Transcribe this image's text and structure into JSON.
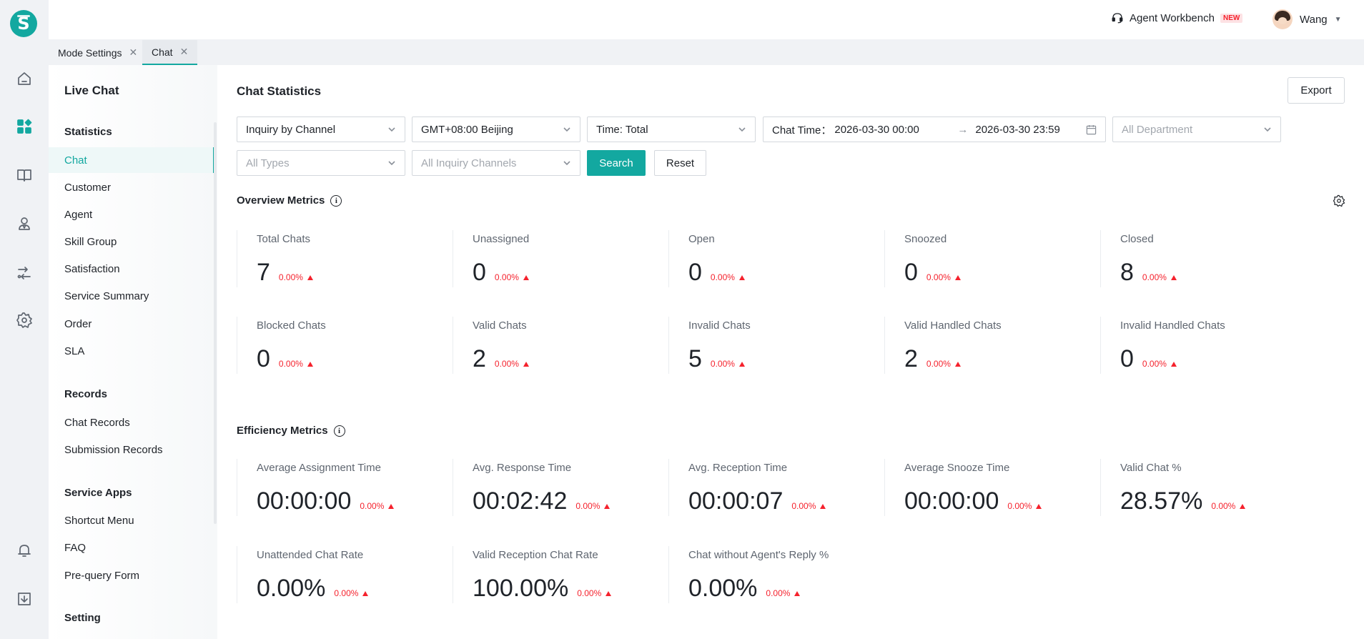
{
  "header": {
    "workbench_label": "Agent Workbench",
    "workbench_badge": "NEW",
    "user_name": "Wang"
  },
  "tabs": [
    {
      "label": "Mode Settings",
      "close": "✕"
    },
    {
      "label": "Chat",
      "close": "✕"
    }
  ],
  "sidebar": {
    "title": "Live Chat",
    "sections": {
      "statistics": "Statistics",
      "records": "Records",
      "service_apps": "Service Apps",
      "setting": "Setting"
    },
    "items": {
      "chat": "Chat",
      "customer": "Customer",
      "agent": "Agent",
      "skill_group": "Skill Group",
      "satisfaction": "Satisfaction",
      "service_summary": "Service Summary",
      "order": "Order",
      "sla": "SLA",
      "chat_records": "Chat Records",
      "submission_records": "Submission Records",
      "shortcut_menu": "Shortcut Menu",
      "faq": "FAQ",
      "prequery_form": "Pre-query Form"
    }
  },
  "main": {
    "title": "Chat Statistics",
    "export_label": "Export",
    "filters": {
      "inquiry": "Inquiry by Channel",
      "timezone": "GMT+08:00 Beijing",
      "time": "Time: Total",
      "chat_time_label": "Chat Time：",
      "chat_time_start": "2026-03-30 00:00",
      "chat_time_arrow": "→",
      "chat_time_end": "2026-03-30 23:59",
      "department_placeholder": "All Department",
      "types_placeholder": "All Types",
      "channels_placeholder": "All Inquiry Channels",
      "search_label": "Search",
      "reset_label": "Reset"
    },
    "overview_title": "Overview Metrics",
    "efficiency_title": "Efficiency Metrics",
    "info_glyph": "i",
    "overview": [
      {
        "label": "Total Chats",
        "value": "7",
        "change": "0.00%"
      },
      {
        "label": "Unassigned",
        "value": "0",
        "change": "0.00%"
      },
      {
        "label": "Open",
        "value": "0",
        "change": "0.00%"
      },
      {
        "label": "Snoozed",
        "value": "0",
        "change": "0.00%"
      },
      {
        "label": "Closed",
        "value": "8",
        "change": "0.00%"
      },
      {
        "label": "Blocked Chats",
        "value": "0",
        "change": "0.00%"
      },
      {
        "label": "Valid Chats",
        "value": "2",
        "change": "0.00%"
      },
      {
        "label": "Invalid Chats",
        "value": "5",
        "change": "0.00%"
      },
      {
        "label": "Valid Handled Chats",
        "value": "2",
        "change": "0.00%"
      },
      {
        "label": "Invalid Handled Chats",
        "value": "0",
        "change": "0.00%"
      }
    ],
    "efficiency": [
      {
        "label": "Average Assignment Time",
        "value": "00:00:00",
        "change": "0.00%"
      },
      {
        "label": "Avg. Response Time",
        "value": "00:02:42",
        "change": "0.00%"
      },
      {
        "label": "Avg. Reception Time",
        "value": "00:00:07",
        "change": "0.00%"
      },
      {
        "label": "Average Snooze Time",
        "value": "00:00:00",
        "change": "0.00%"
      },
      {
        "label": "Valid Chat %",
        "value": "28.57%",
        "change": "0.00%"
      },
      {
        "label": "Unattended Chat Rate",
        "value": "0.00%",
        "change": "0.00%"
      },
      {
        "label": "Valid Reception Chat Rate",
        "value": "100.00%",
        "change": "0.00%"
      },
      {
        "label": "Chat without Agent's Reply %",
        "value": "0.00%",
        "change": "0.00%"
      }
    ]
  },
  "colors": {
    "accent": "#13a8a0",
    "negative": "#f5222d"
  },
  "icons": {
    "rail": [
      "home-icon",
      "apps-icon",
      "book-icon",
      "agent-icon",
      "route-icon",
      "gear-icon",
      "bell-icon",
      "download-icon"
    ]
  }
}
